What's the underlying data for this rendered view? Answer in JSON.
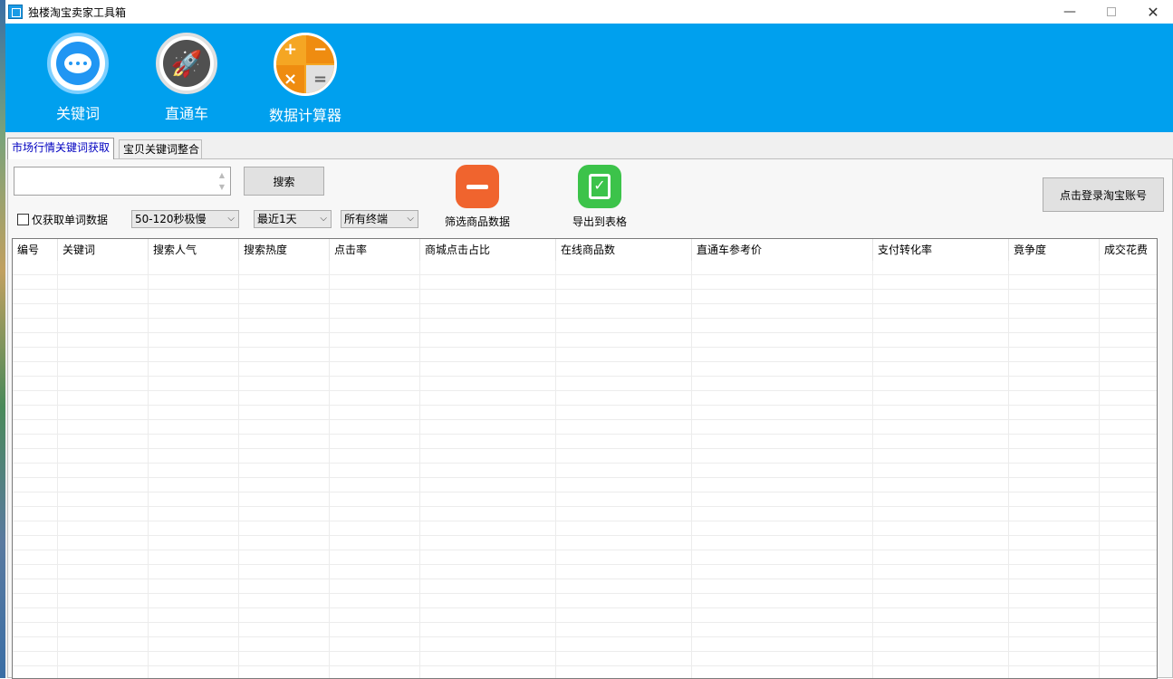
{
  "window": {
    "title": "独楼淘宝卖家工具箱",
    "minimize_glyph": "—",
    "close_glyph": "✕"
  },
  "toolbar": {
    "items": [
      {
        "label": "关键词",
        "icon": "chat-bubble-icon"
      },
      {
        "label": "直通车",
        "icon": "rocket-icon"
      },
      {
        "label": "数据计算器",
        "icon": "calculator-icon"
      }
    ],
    "calc_symbols": [
      "+",
      "−",
      "×",
      "="
    ],
    "rocket_glyph": "🚀"
  },
  "tabs": [
    {
      "label": "市场行情关键词获取",
      "active": true
    },
    {
      "label": "宝贝关键词整合",
      "active": false
    }
  ],
  "search": {
    "value": "",
    "button_label": "搜索"
  },
  "options": {
    "single_word_label": "仅获取单词数据",
    "single_word_checked": false,
    "speed_selected": "50-120秒极慢",
    "range_selected": "最近1天",
    "terminal_selected": "所有终端",
    "dropdown_glyph": "⌵"
  },
  "actions": {
    "filter_label": "筛选商品数据",
    "export_label": "导出到表格",
    "export_glyph": "✓",
    "login_label": "点击登录淘宝账号"
  },
  "table": {
    "columns": [
      "编号",
      "关键词",
      "搜索人气",
      "搜索热度",
      "点击率",
      "商城点击占比",
      "在线商品数",
      "直通车参考价",
      "支付转化率",
      "竟争度",
      "成交花费"
    ],
    "rows": []
  },
  "colors": {
    "toolbar_bg": "#00a0ee",
    "filter_icon": "#f0642e",
    "export_icon": "#3cc34a",
    "active_tab_text": "#0000c0"
  }
}
